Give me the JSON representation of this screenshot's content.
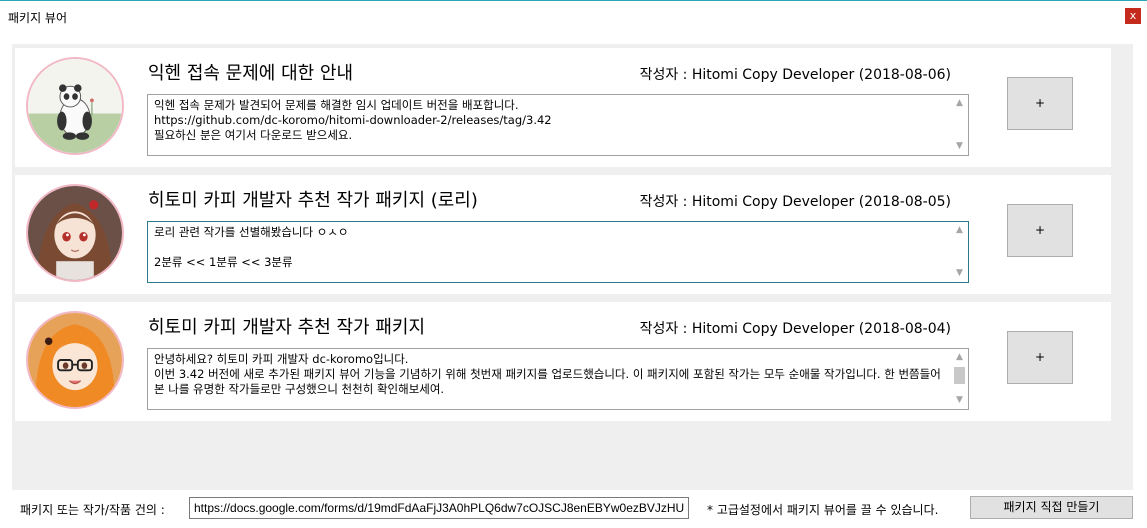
{
  "window": {
    "title": "패키지 뷰어",
    "close_label": "x"
  },
  "packages": [
    {
      "title": "익헨 접속 문제에 대한 안내",
      "author": "작성자 : Hitomi Copy Developer (2018-08-06)",
      "body_lines": [
        "익헨 접속 문제가 발견되어 문제를 해결한 임시 업데이트 버전을 배포합니다.",
        "https://github.com/dc-koromo/hitomi-downloader-2/releases/tag/3.42",
        "필요하신 분은 여기서 다운로드 받으세요."
      ],
      "button_label": "+",
      "avatar_icon": "panda-illustration"
    },
    {
      "title": "히토미 카피 개발자 추천 작가 패키지 (로리)",
      "author": "작성자 : Hitomi Copy Developer (2018-08-05)",
      "body_lines": [
        "로리 관련 작가를 선별해봤습니다 ㅇㅅㅇ",
        "",
        "2분류 << 1분류 << 3분류"
      ],
      "button_label": "+",
      "avatar_icon": "anime-girl-brown-hair"
    },
    {
      "title": "히토미 카피 개발자 추천 작가 패키지",
      "author": "작성자 : Hitomi Copy Developer (2018-08-04)",
      "body_lines": [
        "안녕하세요? 히토미 카피 개발자 dc-koromo입니다.",
        "이번 3.42 버전에 새로 추가된 패키지 뷰어 기능을 기념하기 위해 첫번재 패키지를 업로드했습니다. 이 패키지에 포함된 작가는 모두 순애물 작가입니다. 한 번쯤들어본 나를 유명한 작가들로만 구성했으니 천천히 확인해보세여."
      ],
      "button_label": "+",
      "avatar_icon": "anime-girl-orange-hair-glasses"
    }
  ],
  "footer": {
    "suggest_label": "패키지 또는 작가/작품 건의 :",
    "suggest_url": "https://docs.google.com/forms/d/19mdFdAaFjJ3A0hPLQ6dw7cOJSCJ8enEBYw0ezBVJzHU",
    "hint": "* 고급설정에서 패키지 뷰어를 끌 수 있습니다.",
    "make_button": "패키지 직접 만들기"
  },
  "colors": {
    "accent": "#2aa6b6",
    "list_bg": "#efefef",
    "button_bg": "#e1e1e1",
    "avatar_border": "#f2b8c6",
    "close_bg": "#c42b1c"
  }
}
